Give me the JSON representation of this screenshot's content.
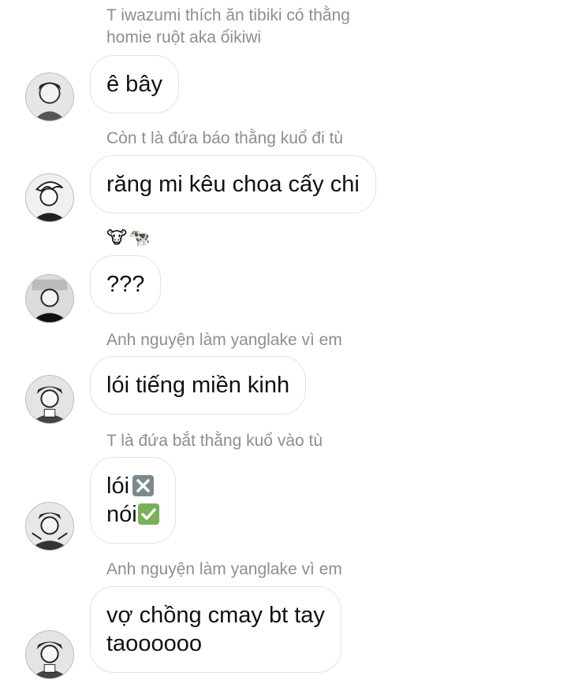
{
  "messages": [
    {
      "sender": "T iwazumi thích ăn tibiki có thằng\nhomie ruột aka ổikiwi",
      "lines": []
    },
    {
      "sender": "",
      "lines": [
        "ê bây"
      ]
    },
    {
      "sender": "Còn t là đứa báo thằng kuổ đi tù",
      "lines": [
        "răng mi kêu choa cấy chi"
      ]
    },
    {
      "sender": "",
      "reactions": [
        "🐮",
        "🐄"
      ],
      "lines": [
        "???"
      ]
    },
    {
      "sender": "Anh nguyện làm yanglake vì em",
      "lines": [
        "lói tiếng miền kinh"
      ]
    },
    {
      "sender": "T là đứa bắt thằng kuổ vào tù",
      "lines": [
        "lói",
        "nói"
      ]
    },
    {
      "sender": "Anh nguyện làm yanglake vì em",
      "lines": [
        "vợ chồng cmay bt tay",
        "taoooooo"
      ]
    }
  ],
  "emojis": {
    "wrong": "cross-mark-button-icon",
    "right": "check-mark-button-icon"
  },
  "colors": {
    "sender_text": "#8e8e8e",
    "bubble_border": "#e3e3e3",
    "message_text": "#111111"
  }
}
